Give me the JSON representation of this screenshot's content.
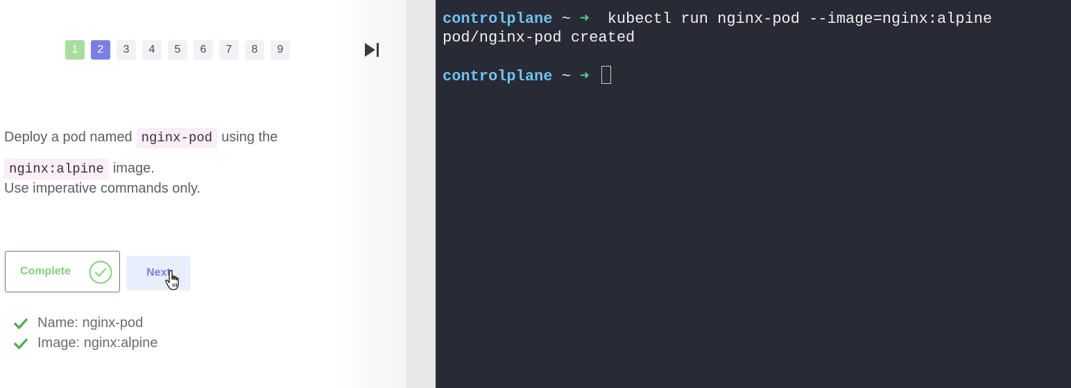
{
  "pagination": {
    "pages": [
      "1",
      "2",
      "3",
      "4",
      "5",
      "6",
      "7",
      "8",
      "9"
    ],
    "completed_page": "1",
    "current_page": "2",
    "skip_icon": "skip-to-end-icon"
  },
  "question": {
    "line1_pre": "Deploy a pod named",
    "pod_name": "nginx-pod",
    "line1_post": "using the",
    "image_code": "nginx:alpine",
    "line2_post": "image.",
    "line3": "Use imperative commands only."
  },
  "buttons": {
    "complete_label": "Complete",
    "complete_icon": "check-circle-icon",
    "next_label": "Next",
    "cursor_icon": "pointer-hand-icon"
  },
  "checks": [
    {
      "label": "Name: nginx-pod",
      "icon": "check-icon"
    },
    {
      "label": "Image: nginx:alpine",
      "icon": "check-icon"
    }
  ],
  "terminal": {
    "host": "controlplane",
    "tilde": "~",
    "arrow": "➜",
    "command": "kubectl run nginx-pod --image=nginx:alpine",
    "output": "pod/nginx-pod created"
  },
  "colors": {
    "terminal_bg": "#282a36",
    "prompt_host": "#6ec3f0",
    "prompt_arrow": "#55d68b",
    "accent": "#7b7fe3",
    "success": "#7dd27a",
    "page_done": "#a7dd9d"
  }
}
